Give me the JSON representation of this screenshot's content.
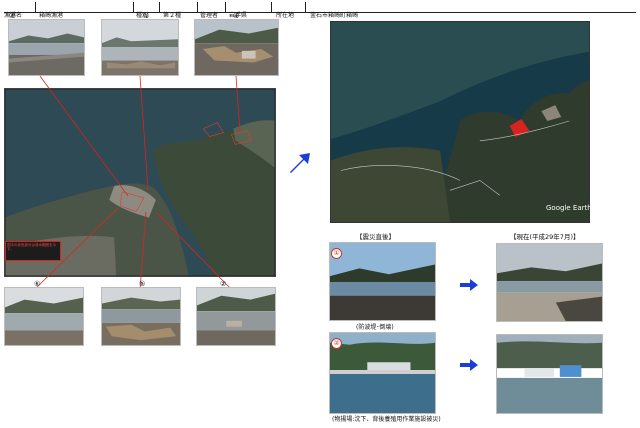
{
  "header": {
    "l1": "漁港名",
    "v1": "箱崎漁港",
    "l2": "種別",
    "v2": "第２種",
    "l3": "管理者",
    "v3": "岩手県",
    "l4": "所在地",
    "v4": "釜石市箱崎町箱崎"
  },
  "top_photos": {
    "n1": "③",
    "n2": "①",
    "n3": "④"
  },
  "bottom_photos": {
    "n1": "⑥",
    "n2": "⑤",
    "n3": "②"
  },
  "map_note": "図中の赤色部分は浸水範囲を示す。",
  "satellite": {
    "watermark": "Google Earth"
  },
  "comparison": {
    "before_title": "【震災直後】",
    "after_title": "【現在(平成29年7月)】",
    "row1_marker": "①",
    "row1_caption": "(防波堤･倒壊)",
    "row2_marker": "②",
    "row2_caption": "(物揚場:沈下、背後養殖用作業施設被災)"
  },
  "colors": {
    "arrow": "#1a3fd6",
    "redline": "#d8241f"
  }
}
